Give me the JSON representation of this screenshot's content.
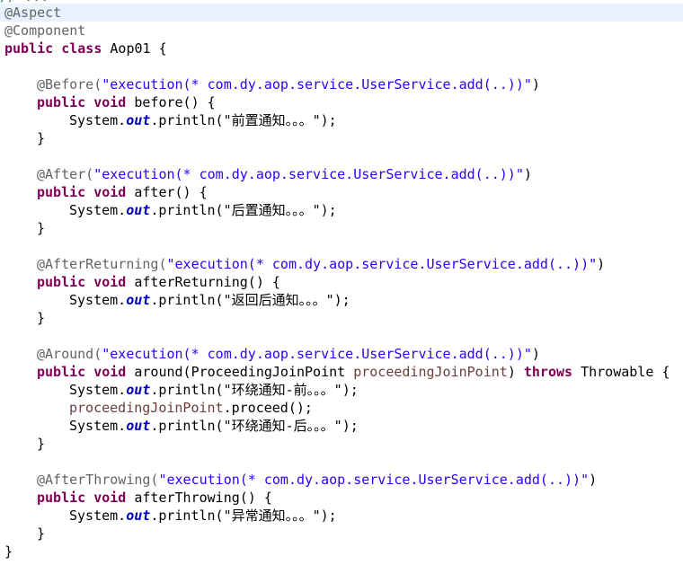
{
  "code": {
    "top_cut": "// ...",
    "aspect": "@Aspect",
    "component": "@Component",
    "class_kw": "public class",
    "class_name": " Aop01 {",
    "before": {
      "ann": "@Before(",
      "expr": "\"execution(* com.dy.aop.service.UserService.add(..))\"",
      "close": ")",
      "mods": "public void",
      "sig": " before() {",
      "sys": "System.",
      "out": "out",
      "call": ".println(",
      "msg": "\"前置通知。。。\"",
      "end": ");"
    },
    "after": {
      "ann": "@After(",
      "expr": "\"execution(* com.dy.aop.service.UserService.add(..))\"",
      "close": ")",
      "mods": "public void",
      "sig": " after() {",
      "sys": "System.",
      "out": "out",
      "call": ".println(",
      "msg": "\"后置通知。。。\"",
      "end": ");"
    },
    "afterReturning": {
      "ann": "@AfterReturning(",
      "expr": "\"execution(* com.dy.aop.service.UserService.add(..))\"",
      "close": ")",
      "mods": "public void",
      "sig": " afterReturning() {",
      "sys": "System.",
      "out": "out",
      "call": ".println(",
      "msg": "\"返回后通知。。。\"",
      "end": ");"
    },
    "around": {
      "ann": "@Around(",
      "expr": "\"execution(* com.dy.aop.service.UserService.add(..))\"",
      "close": ")",
      "mods": "public void",
      "sig_a": " around(ProceedingJoinPoint ",
      "param": "proceedingJoinPoint",
      "sig_b": ") ",
      "throws": "throws",
      "sig_c": " Throwable {",
      "sys": "System.",
      "out": "out",
      "call": ".println(",
      "msg1": "\"环绕通知-前。。。\"",
      "end": ");",
      "proceed_param": "proceedingJoinPoint",
      "proceed_call": ".proceed();",
      "msg2": "\"环绕通知-后。。。\""
    },
    "afterThrowing": {
      "ann": "@AfterThrowing(",
      "expr": "\"execution(* com.dy.aop.service.UserService.add(..))\"",
      "close": ")",
      "mods": "public void",
      "sig": " afterThrowing() {",
      "sys": "System.",
      "out": "out",
      "call": ".println(",
      "msg": "\"异常通知。。。\"",
      "end": ");"
    },
    "close_brace": "}"
  },
  "colors": {
    "annotation": "#646464",
    "keyword": "#7f0055",
    "string": "#2a00ff",
    "static_field": "#0000c0",
    "parameter": "#6a3e3e",
    "current_line": "#e8f2fe"
  }
}
